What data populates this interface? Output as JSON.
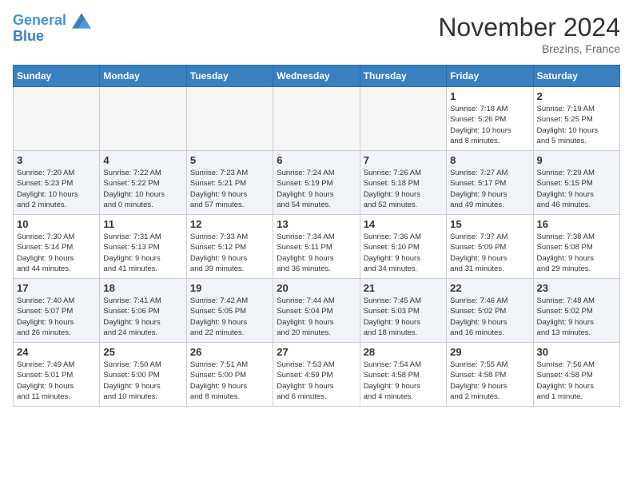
{
  "header": {
    "logo_line1": "General",
    "logo_line2": "Blue",
    "month": "November 2024",
    "location": "Brezins, France"
  },
  "weekdays": [
    "Sunday",
    "Monday",
    "Tuesday",
    "Wednesday",
    "Thursday",
    "Friday",
    "Saturday"
  ],
  "weeks": [
    [
      {
        "day": "",
        "info": ""
      },
      {
        "day": "",
        "info": ""
      },
      {
        "day": "",
        "info": ""
      },
      {
        "day": "",
        "info": ""
      },
      {
        "day": "",
        "info": ""
      },
      {
        "day": "1",
        "info": "Sunrise: 7:18 AM\nSunset: 5:26 PM\nDaylight: 10 hours\nand 8 minutes."
      },
      {
        "day": "2",
        "info": "Sunrise: 7:19 AM\nSunset: 5:25 PM\nDaylight: 10 hours\nand 5 minutes."
      }
    ],
    [
      {
        "day": "3",
        "info": "Sunrise: 7:20 AM\nSunset: 5:23 PM\nDaylight: 10 hours\nand 2 minutes."
      },
      {
        "day": "4",
        "info": "Sunrise: 7:22 AM\nSunset: 5:22 PM\nDaylight: 10 hours\nand 0 minutes."
      },
      {
        "day": "5",
        "info": "Sunrise: 7:23 AM\nSunset: 5:21 PM\nDaylight: 9 hours\nand 57 minutes."
      },
      {
        "day": "6",
        "info": "Sunrise: 7:24 AM\nSunset: 5:19 PM\nDaylight: 9 hours\nand 54 minutes."
      },
      {
        "day": "7",
        "info": "Sunrise: 7:26 AM\nSunset: 5:18 PM\nDaylight: 9 hours\nand 52 minutes."
      },
      {
        "day": "8",
        "info": "Sunrise: 7:27 AM\nSunset: 5:17 PM\nDaylight: 9 hours\nand 49 minutes."
      },
      {
        "day": "9",
        "info": "Sunrise: 7:29 AM\nSunset: 5:15 PM\nDaylight: 9 hours\nand 46 minutes."
      }
    ],
    [
      {
        "day": "10",
        "info": "Sunrise: 7:30 AM\nSunset: 5:14 PM\nDaylight: 9 hours\nand 44 minutes."
      },
      {
        "day": "11",
        "info": "Sunrise: 7:31 AM\nSunset: 5:13 PM\nDaylight: 9 hours\nand 41 minutes."
      },
      {
        "day": "12",
        "info": "Sunrise: 7:33 AM\nSunset: 5:12 PM\nDaylight: 9 hours\nand 39 minutes."
      },
      {
        "day": "13",
        "info": "Sunrise: 7:34 AM\nSunset: 5:11 PM\nDaylight: 9 hours\nand 36 minutes."
      },
      {
        "day": "14",
        "info": "Sunrise: 7:36 AM\nSunset: 5:10 PM\nDaylight: 9 hours\nand 34 minutes."
      },
      {
        "day": "15",
        "info": "Sunrise: 7:37 AM\nSunset: 5:09 PM\nDaylight: 9 hours\nand 31 minutes."
      },
      {
        "day": "16",
        "info": "Sunrise: 7:38 AM\nSunset: 5:08 PM\nDaylight: 9 hours\nand 29 minutes."
      }
    ],
    [
      {
        "day": "17",
        "info": "Sunrise: 7:40 AM\nSunset: 5:07 PM\nDaylight: 9 hours\nand 26 minutes."
      },
      {
        "day": "18",
        "info": "Sunrise: 7:41 AM\nSunset: 5:06 PM\nDaylight: 9 hours\nand 24 minutes."
      },
      {
        "day": "19",
        "info": "Sunrise: 7:42 AM\nSunset: 5:05 PM\nDaylight: 9 hours\nand 22 minutes."
      },
      {
        "day": "20",
        "info": "Sunrise: 7:44 AM\nSunset: 5:04 PM\nDaylight: 9 hours\nand 20 minutes."
      },
      {
        "day": "21",
        "info": "Sunrise: 7:45 AM\nSunset: 5:03 PM\nDaylight: 9 hours\nand 18 minutes."
      },
      {
        "day": "22",
        "info": "Sunrise: 7:46 AM\nSunset: 5:02 PM\nDaylight: 9 hours\nand 16 minutes."
      },
      {
        "day": "23",
        "info": "Sunrise: 7:48 AM\nSunset: 5:02 PM\nDaylight: 9 hours\nand 13 minutes."
      }
    ],
    [
      {
        "day": "24",
        "info": "Sunrise: 7:49 AM\nSunset: 5:01 PM\nDaylight: 9 hours\nand 11 minutes."
      },
      {
        "day": "25",
        "info": "Sunrise: 7:50 AM\nSunset: 5:00 PM\nDaylight: 9 hours\nand 10 minutes."
      },
      {
        "day": "26",
        "info": "Sunrise: 7:51 AM\nSunset: 5:00 PM\nDaylight: 9 hours\nand 8 minutes."
      },
      {
        "day": "27",
        "info": "Sunrise: 7:53 AM\nSunset: 4:59 PM\nDaylight: 9 hours\nand 6 minutes."
      },
      {
        "day": "28",
        "info": "Sunrise: 7:54 AM\nSunset: 4:58 PM\nDaylight: 9 hours\nand 4 minutes."
      },
      {
        "day": "29",
        "info": "Sunrise: 7:55 AM\nSunset: 4:58 PM\nDaylight: 9 hours\nand 2 minutes."
      },
      {
        "day": "30",
        "info": "Sunrise: 7:56 AM\nSunset: 4:58 PM\nDaylight: 9 hours\nand 1 minute."
      }
    ]
  ]
}
